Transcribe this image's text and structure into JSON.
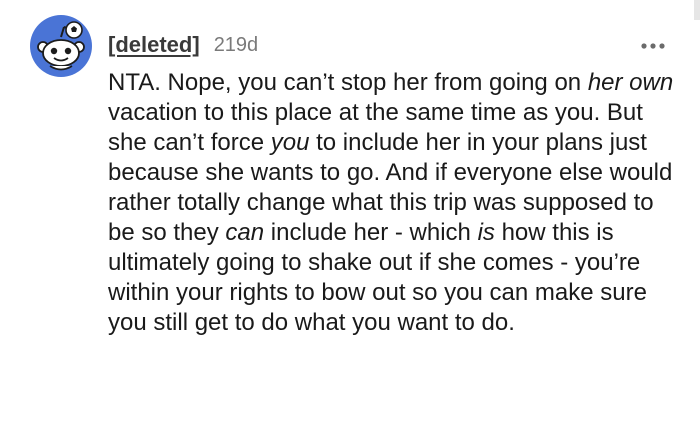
{
  "comment": {
    "username": "[deleted]",
    "age": "219d",
    "avatar_icon": "snoo-avatar-icon",
    "more_icon": "more-options-icon",
    "body_segments": [
      {
        "text": "NTA. Nope, you can’t stop her from going on ",
        "italic": false
      },
      {
        "text": "her own",
        "italic": true
      },
      {
        "text": " vacation to this place at the same time as you. But she can’t force ",
        "italic": false
      },
      {
        "text": "you",
        "italic": true
      },
      {
        "text": " to include her in your plans just because she wants to go. And if everyone else would rather totally change what this trip was supposed to be so they ",
        "italic": false
      },
      {
        "text": "can",
        "italic": true
      },
      {
        "text": " include her - which ",
        "italic": false
      },
      {
        "text": "is",
        "italic": true
      },
      {
        "text": " how this is ultimately going to shake out if she comes - you’re within your rights to bow out so you can make sure you still get to do what you want to do.",
        "italic": false
      }
    ]
  },
  "colors": {
    "avatar_bg": "#4a74d6",
    "text": "#1a1a1a",
    "meta": "#7a7a7a"
  }
}
